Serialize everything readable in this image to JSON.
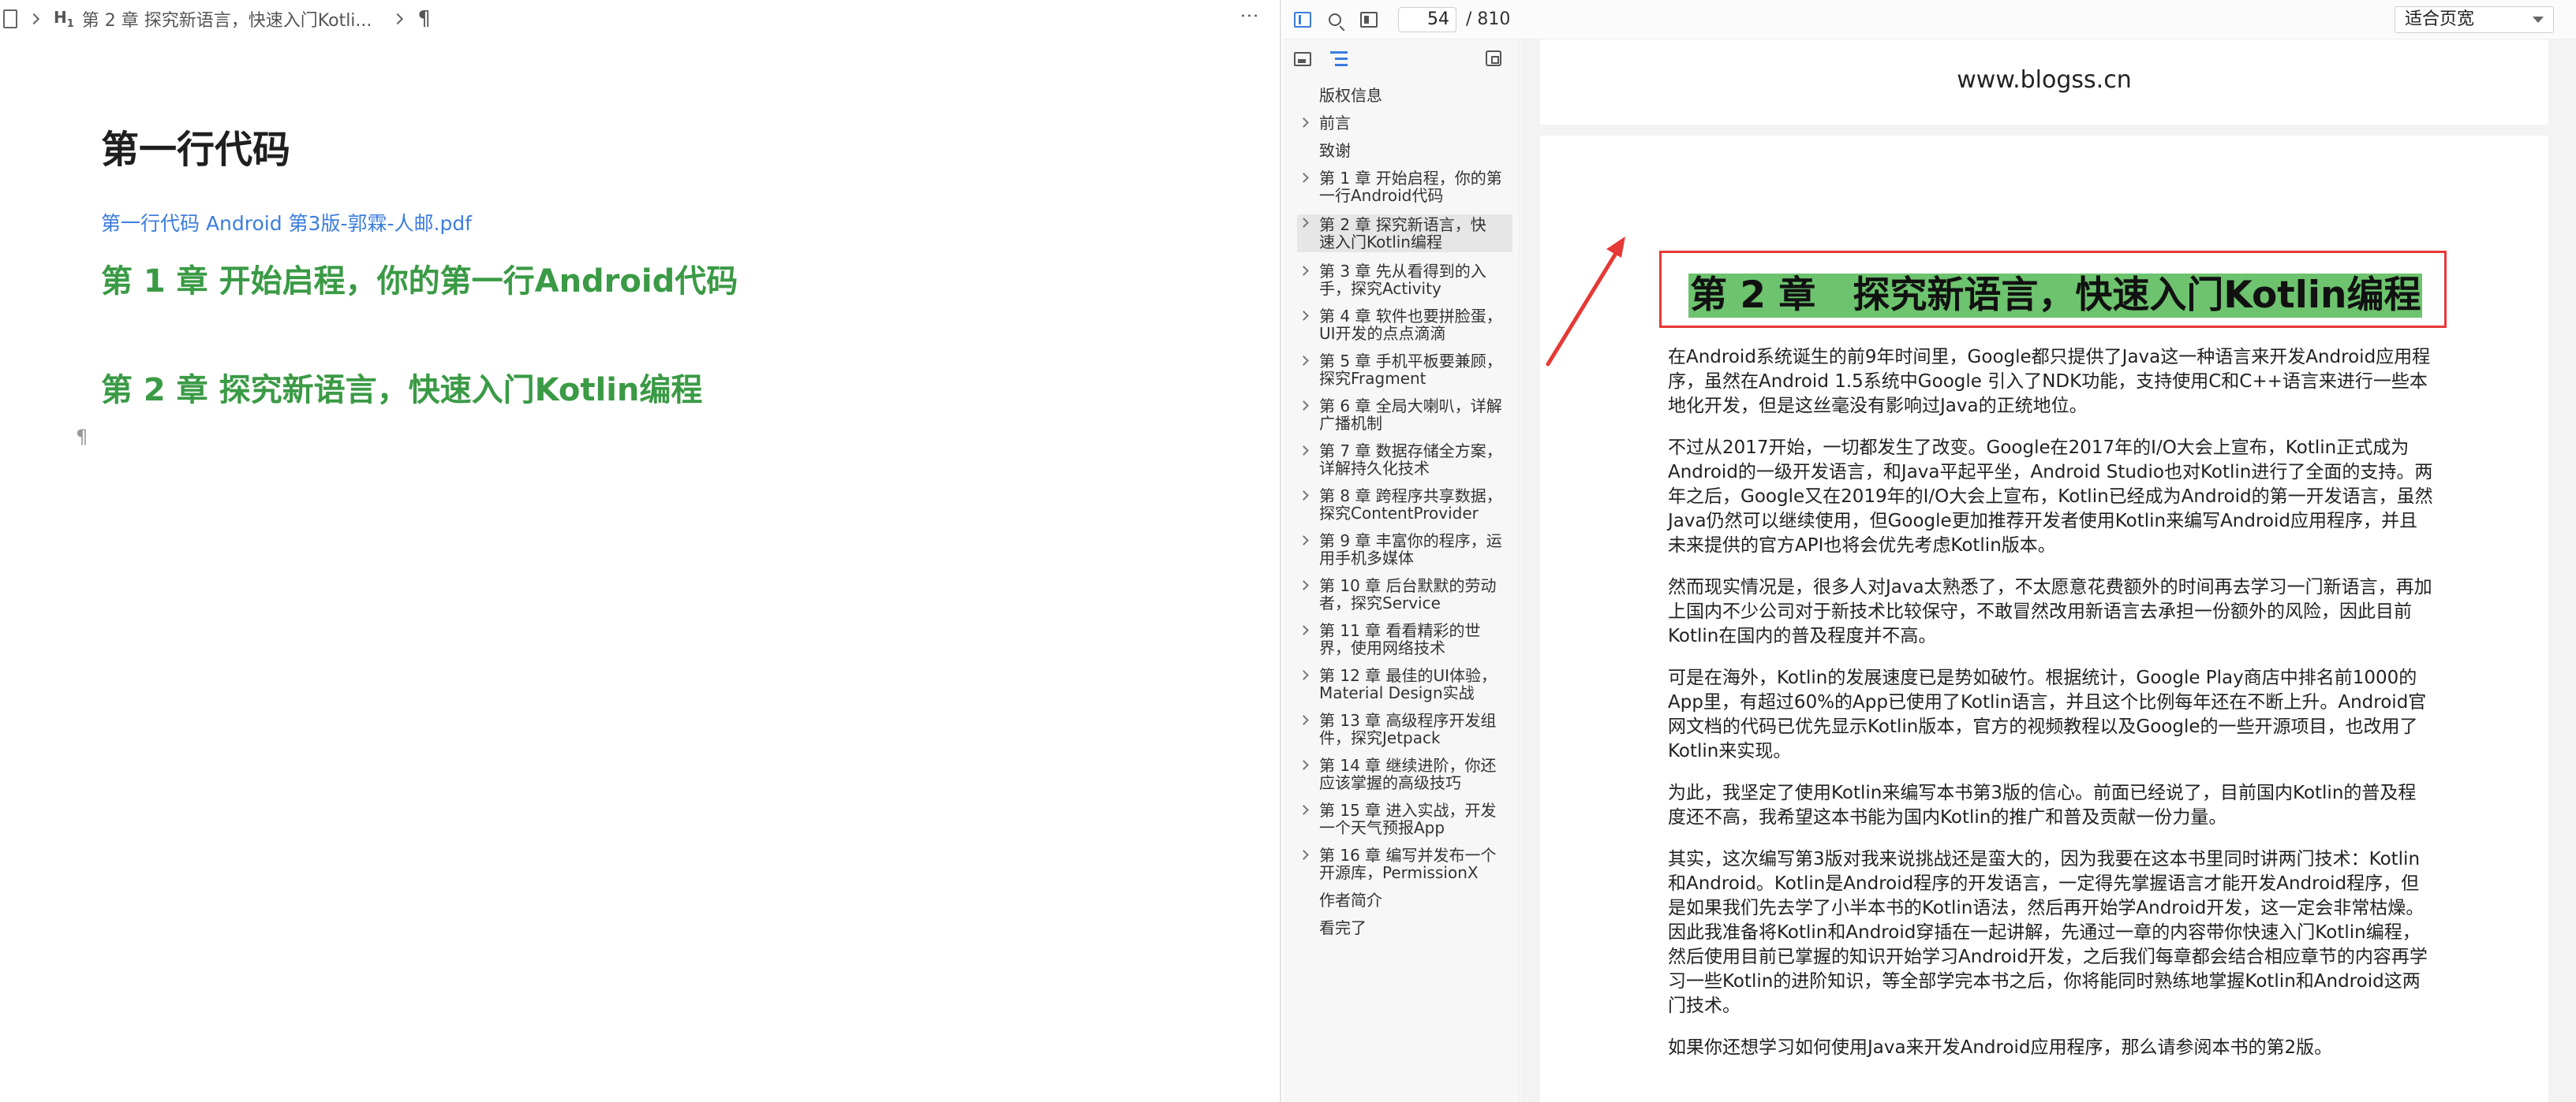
{
  "editor": {
    "breadcrumb_heading_tag": "H",
    "breadcrumb_heading_level": "1",
    "breadcrumb_text": "第 2 章 探究新语言，快速入门Kotli...",
    "pilcrow": "¶",
    "more": "⋮",
    "doc_title": "第一行代码",
    "doc_link": "第一行代码 Android 第3版-郭霖-人邮.pdf",
    "chapter_1": "第 1 章 开始启程，你的第一行Android代码",
    "chapter_2": "第 2 章 探究新语言，快速入门Kotlin编程",
    "end_pilcrow": "¶"
  },
  "pdf_toolbar": {
    "current_page": "54",
    "total_pages": "/ 810",
    "zoom": "适合页宽"
  },
  "outline": [
    {
      "label": "版权信息",
      "has_children": false,
      "selected": false
    },
    {
      "label": "前言",
      "has_children": true,
      "selected": false
    },
    {
      "label": "致谢",
      "has_children": false,
      "selected": false
    },
    {
      "label": "第 1 章 开始启程，你的第一行Android代码",
      "has_children": true,
      "selected": false
    },
    {
      "label": "第 2 章 探究新语言，快速入门Kotlin编程",
      "has_children": true,
      "selected": true
    },
    {
      "label": "第 3 章 先从看得到的入手，探究Activity",
      "has_children": true,
      "selected": false
    },
    {
      "label": "第 4 章 软件也要拼脸蛋，UI开发的点点滴滴",
      "has_children": true,
      "selected": false
    },
    {
      "label": "第 5 章 手机平板要兼顾，探究Fragment",
      "has_children": true,
      "selected": false
    },
    {
      "label": "第 6 章 全局大喇叭，详解广播机制",
      "has_children": true,
      "selected": false
    },
    {
      "label": "第 7 章 数据存储全方案，详解持久化技术",
      "has_children": true,
      "selected": false
    },
    {
      "label": "第 8 章 跨程序共享数据，探究ContentProvider",
      "has_children": true,
      "selected": false
    },
    {
      "label": "第 9 章 丰富你的程序，运用手机多媒体",
      "has_children": true,
      "selected": false
    },
    {
      "label": "第 10 章 后台默默的劳动者，探究Service",
      "has_children": true,
      "selected": false
    },
    {
      "label": "第 11 章 看看精彩的世界，使用网络技术",
      "has_children": true,
      "selected": false
    },
    {
      "label": "第 12 章 最佳的UI体验，Material Design实战",
      "has_children": true,
      "selected": false
    },
    {
      "label": "第 13 章 高级程序开发组件，探究Jetpack",
      "has_children": true,
      "selected": false
    },
    {
      "label": "第 14 章 继续进阶，你还应该掌握的高级技巧",
      "has_children": true,
      "selected": false
    },
    {
      "label": "第 15 章 进入实战，开发一个天气预报App",
      "has_children": true,
      "selected": false
    },
    {
      "label": "第 16 章 编写并发布一个开源库，PermissionX",
      "has_children": true,
      "selected": false
    },
    {
      "label": "作者简介",
      "has_children": false,
      "selected": false
    },
    {
      "label": "看完了",
      "has_children": false,
      "selected": false
    }
  ],
  "pdf": {
    "watermark": "www.blogss.cn",
    "chapter_title": "第 2 章　探究新语言，快速入门Kotlin编程",
    "paragraphs": [
      "在Android系统诞生的前9年时间里，Google都只提供了Java这一种语言来开发Android应用程序，虽然在Android 1.5系统中Google 引入了NDK功能，支持使用C和C++语言来进行一些本地化开发，但是这丝毫没有影响过Java的正统地位。",
      "不过从2017开始，一切都发生了改变。Google在2017年的I/O大会上宣布，Kotlin正式成为Android的一级开发语言，和Java平起平坐，Android Studio也对Kotlin进行了全面的支持。两年之后，Google又在2019年的I/O大会上宣布，Kotlin已经成为Android的第一开发语言，虽然Java仍然可以继续使用，但Google更加推荐开发者使用Kotlin来编写Android应用程序，并且未来提供的官方API也将会优先考虑Kotlin版本。",
      "然而现实情况是，很多人对Java太熟悉了，不太愿意花费额外的时间再去学习一门新语言，再加上国内不少公司对于新技术比较保守，不敢冒然改用新语言去承担一份额外的风险，因此目前Kotlin在国内的普及程度并不高。",
      "可是在海外，Kotlin的发展速度已是势如破竹。根据统计，Google Play商店中排名前1000的App里，有超过60%的App已使用了Kotlin语言，并且这个比例每年还在不断上升。Android官网文档的代码已优先显示Kotlin版本，官方的视频教程以及Google的一些开源项目，也改用了Kotlin来实现。",
      "为此，我坚定了使用Kotlin来编写本书第3版的信心。前面已经说了，目前国内Kotlin的普及程度还不高，我希望这本书能为国内Kotlin的推广和普及贡献一份力量。",
      "其实，这次编写第3版对我来说挑战还是蛮大的，因为我要在这本书里同时讲两门技术：Kotlin和Android。Kotlin是Android程序的开发语言，一定得先掌握语言才能开发Android程序，但是如果我们先去学了小半本书的Kotlin语法，然后再开始学Android开发，这一定会非常枯燥。因此我准备将Kotlin和Android穿插在一起讲解，先通过一章的内容带你快速入门Kotlin编程，然后使用目前已掌握的知识开始学习Android开发，之后我们每章都会结合相应章节的内容再学习一些Kotlin的进阶知识，等全部学完本书之后，你将能同时熟练地掌握Kotlin和Android这两门技术。",
      "如果你还想学习如何使用Java来开发Android应用程序，那么请参阅本书的第2版。"
    ]
  },
  "colors": {
    "heading_green": "#3a9a45",
    "link_blue": "#3b7ddd",
    "highlight_green": "#6dc36e",
    "annotation_red": "#e53935"
  }
}
